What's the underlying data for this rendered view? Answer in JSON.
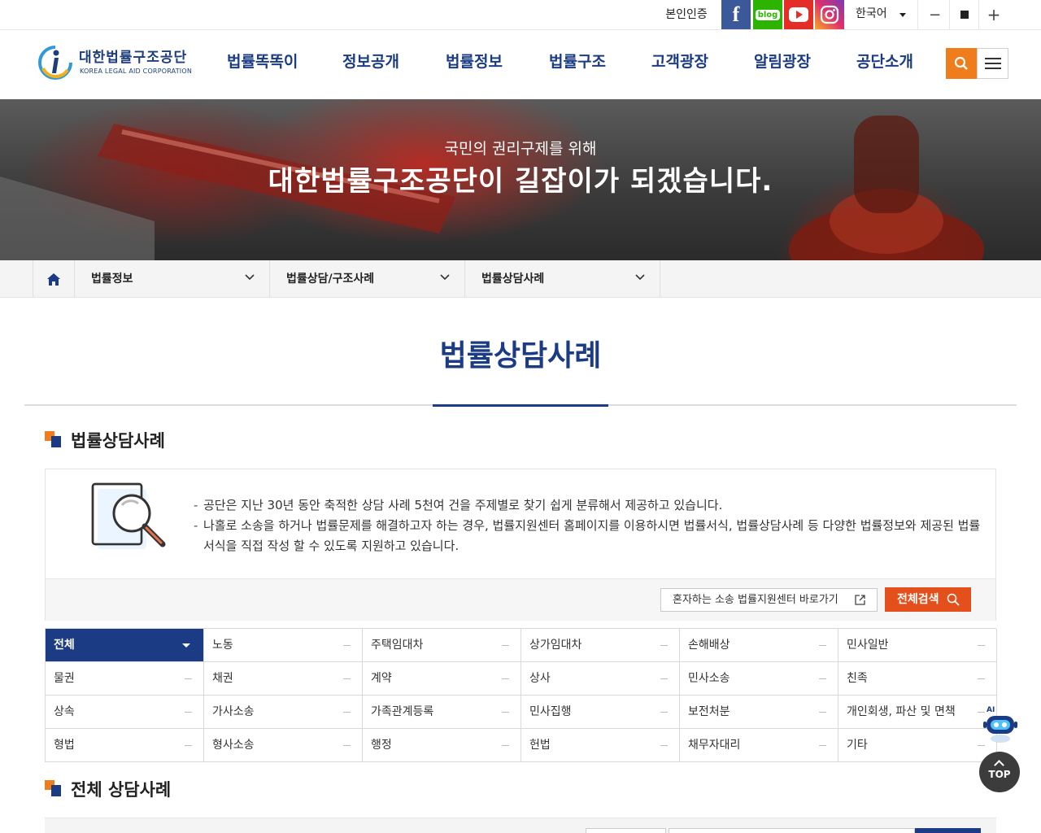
{
  "util": {
    "auth": "본인인증",
    "sns": {
      "facebook": "f",
      "blog": "blog"
    },
    "language": "한국어"
  },
  "logo": {
    "ko": "대한법률구조공단",
    "en": "KOREA LEGAL AID CORPORATION"
  },
  "gnb": [
    "법률똑똑이",
    "정보공개",
    "법률정보",
    "법률구조",
    "고객광장",
    "알림광장",
    "공단소개"
  ],
  "hero": {
    "top": "국민의 권리구제를 위해",
    "main": "대한법률구조공단이 길잡이가 되겠습니다."
  },
  "location": [
    "법률정보",
    "법률상담/구조사례",
    "법률상담사례"
  ],
  "page_title": "법률상담사례",
  "section1_title": "법률상담사례",
  "intro": {
    "lines": [
      "공단은 지난 30년 동안 축적한 상담 사례 5천여 건을 주제별로 찾기 쉽게 분류해서 제공하고 있습니다.",
      "나홀로 소송을 하거나 법률문제를 해결하고자 하는 경우, 법률지원센터 홈페이지를 이용하시면 법률서식, 법률상담사례 등 다양한 법률정보와 제공된 법률서식을 직접 작성 할 수 있도록 지원하고 있습니다."
    ],
    "link_button": "혼자하는 소송 법률지원센터 바로가기",
    "search_button": "전체검색"
  },
  "categories": [
    "전체",
    "노동",
    "주택임대차",
    "상가임대차",
    "손해배상",
    "민사일반",
    "물권",
    "채권",
    "계약",
    "상사",
    "민사소송",
    "친족",
    "상속",
    "가사소송",
    "가족관계등록",
    "민사집행",
    "보전처분",
    "개인회생, 파산 및 면책",
    "형법",
    "형사소송",
    "행정",
    "헌법",
    "채무자대리",
    "기타"
  ],
  "active_category": "전체",
  "section2_title": "전체 상담사례",
  "floating": {
    "ai": "AI",
    "top": "TOP"
  },
  "colors": {
    "primary": "#1b3c84",
    "accent": "#f07d1b",
    "search_button": "#e3501b"
  }
}
